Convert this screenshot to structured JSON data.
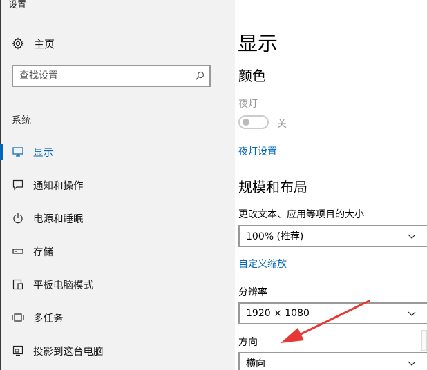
{
  "window": {
    "title": "设置"
  },
  "sidebar": {
    "home_label": "主页",
    "search_placeholder": "查找设置",
    "section_label": "系统",
    "items": [
      {
        "label": "显示",
        "icon": "monitor-icon",
        "active": true
      },
      {
        "label": "通知和操作",
        "icon": "notification-icon",
        "active": false
      },
      {
        "label": "电源和睡眠",
        "icon": "power-icon",
        "active": false
      },
      {
        "label": "存储",
        "icon": "storage-icon",
        "active": false
      },
      {
        "label": "平板电脑模式",
        "icon": "tablet-mode-icon",
        "active": false
      },
      {
        "label": "多任务",
        "icon": "multitasking-icon",
        "active": false
      },
      {
        "label": "投影到这台电脑",
        "icon": "project-icon",
        "active": false
      }
    ]
  },
  "main": {
    "title": "显示",
    "color_section": {
      "heading": "颜色",
      "night_light_label": "夜灯",
      "night_light_state": "关",
      "night_light_settings_link": "夜灯设置"
    },
    "scale_section": {
      "heading": "规模和布局",
      "scale_label": "更改文本、应用等项目的大小",
      "scale_value": "100% (推荐)",
      "custom_scaling_link": "自定义缩放",
      "resolution_label": "分辨率",
      "resolution_value": "1920 × 1080",
      "orientation_label": "方向",
      "orientation_value": "横向"
    }
  },
  "colors": {
    "accent": "#0067b8",
    "sidebar_bg": "#f2f2f2",
    "muted_text": "#999999",
    "annotation_arrow": "#e53935"
  }
}
